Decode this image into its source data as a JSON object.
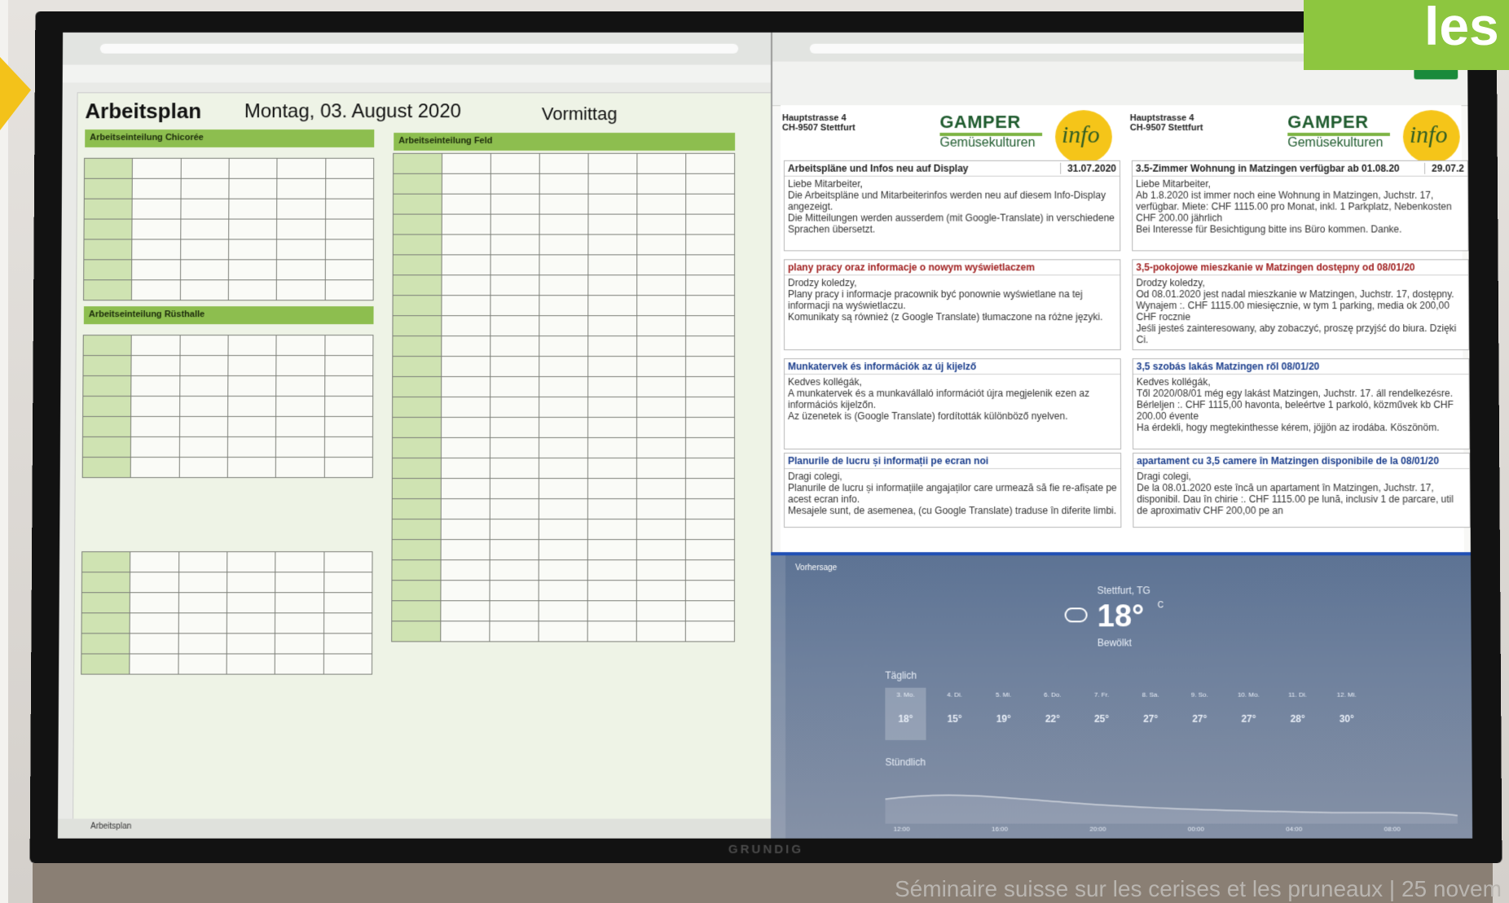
{
  "slide": {
    "banner_text": "les",
    "footer": "Séminaire suisse sur les cerises et les pruneaux | 25 novem"
  },
  "tv": {
    "brand": "GRUNDIG"
  },
  "spreadsheet": {
    "title": "Arbeitsplan",
    "date": "Montag, 03. August 2020",
    "shift": "Vormittag",
    "sheet_tab": "Arbeitsplan",
    "groups": [
      {
        "heading": "Arbeitseinteilung Chicorée"
      },
      {
        "heading": "Arbeitseinteilung Rüsthalle"
      },
      {
        "heading": "Arbeitseinteilung Feld"
      }
    ]
  },
  "doc": {
    "company_name": "GAMPER",
    "company_sub": "Gemüsekulturen",
    "info_logo": "info",
    "address_line1": "Hauptstrasse 4",
    "address_line2": "CH-9507 Stettfurt",
    "notes_left": [
      {
        "title": "Arbeitspläne und Infos neu auf Display",
        "date": "31.07.2020",
        "color": "default",
        "lines": [
          "Liebe Mitarbeiter,",
          "Die Arbeitspläne und Mitarbeiterinfos werden neu auf diesem Info-Display angezeigt.",
          "Die Mitteilungen werden ausserdem (mit Google-Translate) in verschiedene Sprachen übersetzt."
        ]
      },
      {
        "title": "plany pracy oraz informacje o nowym wyświetlaczem",
        "date": "",
        "color": "red",
        "lines": [
          "Drodzy koledzy,",
          "Plany pracy i informacje pracownik być ponownie wyświetlane na tej informacji na wyświetlaczu.",
          "Komunikaty są również (z Google Translate) tłumaczone na różne języki."
        ]
      },
      {
        "title": "Munkatervek és információk az új kijelző",
        "date": "",
        "color": "blue",
        "lines": [
          "Kedves kollégák,",
          "A munkatervek és a munkavállaló információt újra megjelenik ezen az információs kijelzőn.",
          "Az üzenetek is (Google Translate) fordították különböző nyelven."
        ]
      },
      {
        "title": "Planurile de lucru și informații pe ecran noi",
        "date": "",
        "color": "blue",
        "lines": [
          "Dragi colegi,",
          "Planurile de lucru și informațiile angajaților care urmează să fie re-afișate pe acest ecran info.",
          "Mesajele sunt, de asemenea, (cu Google Translate) traduse în diferite limbi."
        ]
      }
    ],
    "notes_right": [
      {
        "title": "3.5-Zimmer Wohnung in Matzingen verfügbar ab 01.08.20",
        "date": "29.07.2",
        "color": "default",
        "lines": [
          "Liebe Mitarbeiter,",
          "Ab 1.8.2020 ist immer noch eine Wohnung in Matzingen, Juchstr. 17, verfügbar. Miete: CHF 1115.00 pro Monat, inkl. 1 Parkplatz, Nebenkosten CHF 200.00 jährlich",
          "Bei Interesse für Besichtigung bitte ins Büro kommen. Danke."
        ]
      },
      {
        "title": "3,5-pokojowe mieszkanie w Matzingen dostępny od 08/01/20",
        "date": "",
        "color": "red",
        "lines": [
          "Drodzy koledzy,",
          "Od 08.01.2020 jest nadal mieszkanie w Matzingen, Juchstr. 17, dostępny. Wynajem :. CHF 1115.00 miesięcznie, w tym 1 parking, media ok 200,00 CHF rocznie",
          "Jeśli jesteś zainteresowany, aby zobaczyć, proszę przyjść do biura. Dzięki Ci."
        ]
      },
      {
        "title": "3,5 szobás lakás Matzingen ről 08/01/20",
        "date": "",
        "color": "blue",
        "lines": [
          "Kedves kollégák,",
          "Től 2020/08/01 még egy lakást Matzingen, Juchstr. 17. áll rendelkezésre. Bérleljen :. CHF 1115,00 havonta, beleértve 1 parkoló, közművek kb CHF 200.00 évente",
          "Ha érdekli, hogy megtekinthesse kérem, jöjjön az irodába. Köszönöm."
        ]
      },
      {
        "title": "apartament cu 3,5 camere în Matzingen disponibile de la 08/01/20",
        "date": "",
        "color": "blue",
        "lines": [
          "Dragi colegi,",
          "De la 08.01.2020 este încă un apartament în Matzingen, Juchstr. 17, disponibil. Dau în chirie :. CHF 1115.00 pe lună, inclusiv 1 de parcare, util de aproximativ CHF 200,00 pe an"
        ]
      }
    ]
  },
  "weather": {
    "window_title": "Vorhersage",
    "location": "Stettfurt, TG",
    "temperature": "18°",
    "unit": "C",
    "condition": "Bewölkt",
    "daily_label": "Täglich",
    "hourly_label": "Stündlich",
    "days": [
      {
        "name": "3. Mo.",
        "temp": "18°"
      },
      {
        "name": "4. Di.",
        "temp": "15°"
      },
      {
        "name": "5. Mi.",
        "temp": "19°"
      },
      {
        "name": "6. Do.",
        "temp": "22°"
      },
      {
        "name": "7. Fr.",
        "temp": "25°"
      },
      {
        "name": "8. Sa.",
        "temp": "27°"
      },
      {
        "name": "9. So.",
        "temp": "27°"
      },
      {
        "name": "10. Mo.",
        "temp": "27°"
      },
      {
        "name": "11. Di.",
        "temp": "28°"
      },
      {
        "name": "12. Mi.",
        "temp": "30°"
      }
    ],
    "hours": [
      "12:00",
      "16:00",
      "20:00",
      "00:00",
      "04:00",
      "08:00"
    ]
  }
}
